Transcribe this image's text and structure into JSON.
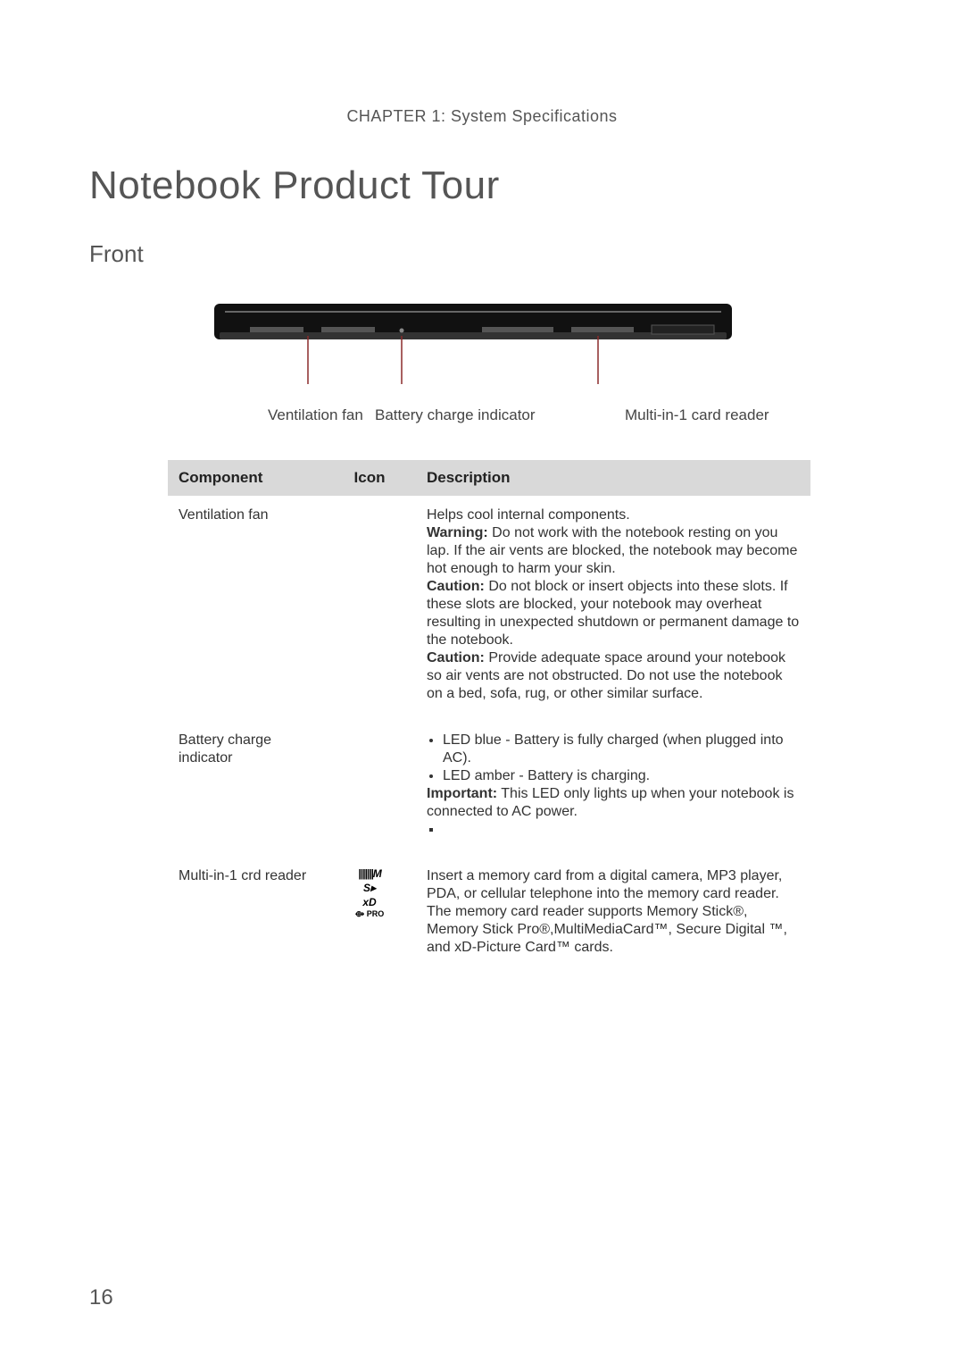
{
  "chapter": "CHAPTER 1: System Specifications",
  "title": "Notebook Product Tour",
  "section": "Front",
  "callouts": {
    "ventilation": "Ventilation fan",
    "battery": "Battery charge indicator",
    "reader": "Multi-in-1 card reader"
  },
  "table": {
    "headers": {
      "component": "Component",
      "icon": "Icon",
      "description": "Description"
    },
    "rows": [
      {
        "component": "Ventilation fan",
        "icon": "",
        "desc": {
          "intro": "Helps cool internal components.",
          "warn_label": "Warning:",
          "warn_text": " Do not work with the notebook resting on you lap. If the air vents are blocked, the notebook may become hot enough to harm your skin.",
          "caution1_label": "Caution:",
          "caution1_text": " Do not block or insert objects into these slots. If these slots are blocked, your notebook may overheat resulting in unexpected shutdown or permanent damage to the notebook.",
          "caution2_label": "Caution:",
          "caution2_text": " Provide adequate space around your notebook so air vents are not obstructed. Do not use the notebook on a bed, sofa, rug, or other similar surface."
        }
      },
      {
        "component": "Battery charge indicator",
        "icon": "",
        "desc": {
          "b1": "LED blue - Battery is fully charged (when plugged into AC).",
          "b2": "LED amber - Battery is charging.",
          "imp_label": "Important:",
          "imp_text": " This LED only lights up when your notebook is connected to AC power."
        }
      },
      {
        "component": "Multi-in-1 crd reader",
        "icon_lines": {
          "l1": "|||||||M",
          "l2": "S▸",
          "l3": "xD",
          "l4": "⟴ PRO"
        },
        "desc": {
          "text": "Insert a memory card from a digital camera, MP3 player, PDA, or cellular telephone into the memory card reader. The memory card reader supports Memory Stick®, Memory Stick Pro®,MultiMediaCard™, Secure Digital ™, and xD-Picture Card™ cards."
        }
      }
    ]
  },
  "page_number": "16"
}
